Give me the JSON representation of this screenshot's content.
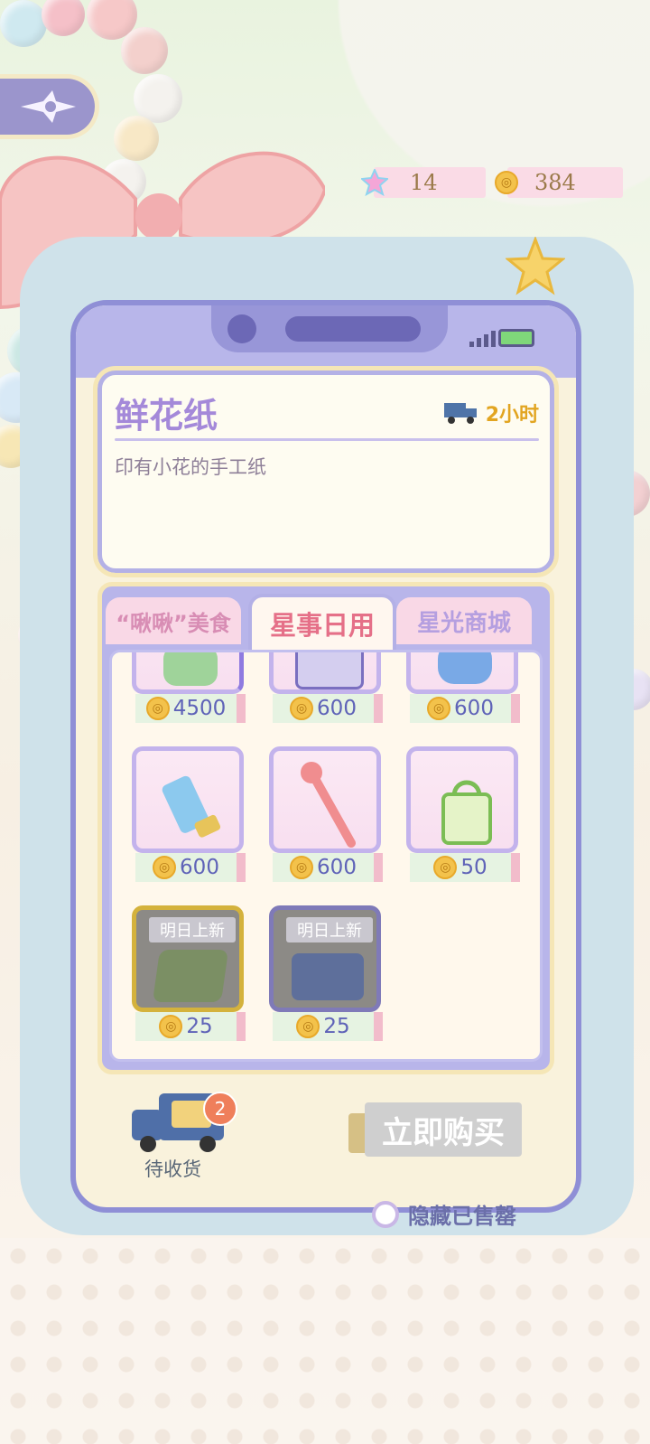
{
  "currency": {
    "stars": "14",
    "coins": "384"
  },
  "item": {
    "name": "鲜花纸",
    "delivery": "2小时",
    "description": "印有小花的手工纸"
  },
  "tabs": [
    "“啾啾”美食",
    "星事日用",
    "星光商城"
  ],
  "shop_items": [
    {
      "price": "4500",
      "icon": "green-jar-icon"
    },
    {
      "price": "600",
      "icon": "notebook-icon"
    },
    {
      "price": "600",
      "icon": "blue-fish-icon"
    },
    {
      "price": "600",
      "icon": "tube-cream-icon"
    },
    {
      "price": "600",
      "icon": "bear-pen-icon"
    },
    {
      "price": "50",
      "icon": "shopping-bag-icon"
    },
    {
      "price": "25",
      "icon": "flower-paper-icon",
      "tag": "明日上新"
    },
    {
      "price": "25",
      "icon": "paint-box-icon",
      "tag": "明日上新"
    }
  ],
  "buy_button": "立即购买",
  "delivery_truck": {
    "label": "待收货",
    "count": "2"
  },
  "hide_sold": "隐藏已售罄"
}
